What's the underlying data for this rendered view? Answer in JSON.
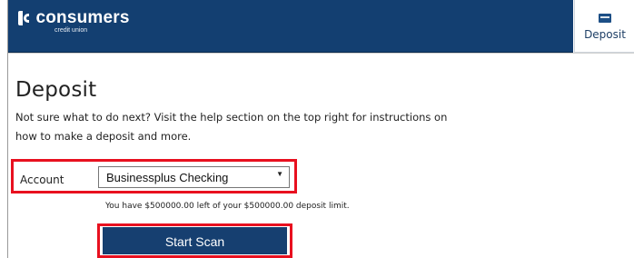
{
  "header": {
    "logo_word": "consumers",
    "logo_sub": "credit union",
    "nav_deposit_label": "Deposit"
  },
  "main": {
    "title": "Deposit",
    "intro": "Not sure what to do next? Visit the help section on the top right for instructions on how to make a deposit and more.",
    "account_label": "Account",
    "account_selected": "Businessplus Checking",
    "limit_text": "You have $500000.00 left of your $500000.00 deposit limit.",
    "start_scan_label": "Start Scan"
  },
  "colors": {
    "header_bg": "#133f71",
    "button_bg": "#163f70",
    "highlight": "#e8101f"
  },
  "icons": {
    "nav_deposit": "check-card-icon",
    "select_arrow": "triangle-down-icon",
    "logo": "consumers-logo-mark"
  }
}
